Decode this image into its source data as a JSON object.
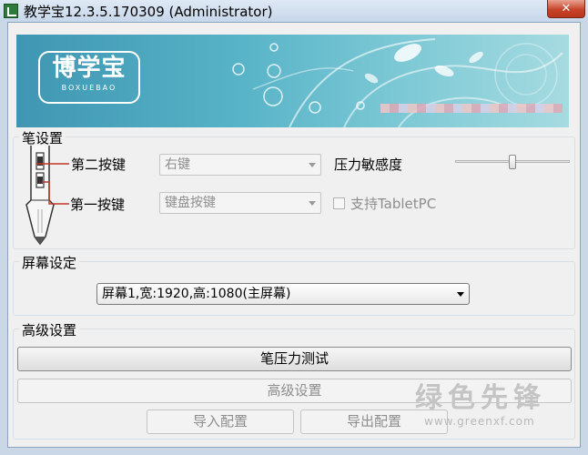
{
  "window": {
    "title": "教学宝12.3.5.170309 (Administrator)",
    "close_label": "✕"
  },
  "banner": {
    "logo_text": "博学宝",
    "logo_sub": "BOXUEBAO"
  },
  "pen_settings": {
    "group_label": "笔设置",
    "second_button_label": "第二按键",
    "second_button_value": "右键",
    "first_button_label": "第一按键",
    "first_button_value": "键盘按键",
    "pressure_label": "压力敏感度",
    "pressure_level": 0.5,
    "tablet_pc_label": "支持TabletPC",
    "tablet_pc_checked": false
  },
  "screen_settings": {
    "group_label": "屏幕设定",
    "screen_value": "屏幕1,宽:1920,高:1080(主屏幕)"
  },
  "advanced_settings": {
    "group_label": "高级设置",
    "pressure_test_button": "笔压力测试",
    "advanced_button": "高级设置",
    "import_button": "导入配置",
    "export_button": "导出配置"
  },
  "watermark": {
    "main": "绿色先锋",
    "sub": "www.greenxf.com"
  },
  "colors": {
    "title_bar": "#c7d7ea",
    "banner": "#57b3c7",
    "close_button": "#c7442a",
    "pen_guide_lines": "#c0392b"
  }
}
